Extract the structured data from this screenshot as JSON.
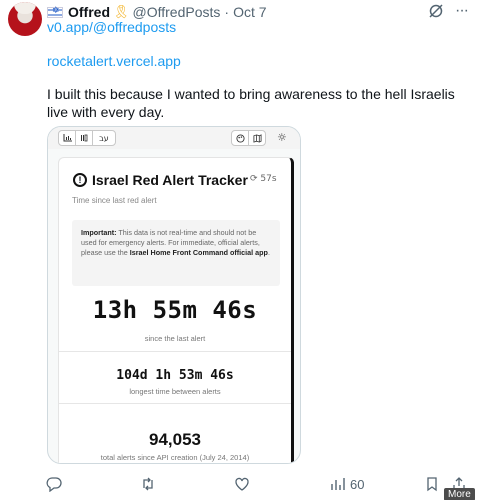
{
  "author": {
    "name": "Offred",
    "handle": "@OffredPosts",
    "separator": "·",
    "date": "Oct 7"
  },
  "post": {
    "link_top": "v0.app/@offredposts",
    "link": "rocketalert.vercel.app",
    "text": "I built this because I wanted to bring awareness to the hell Israelis live with every day."
  },
  "embed": {
    "toolbar": {
      "hebrew_button": "עב"
    },
    "title": "Israel Red Alert Tracker",
    "refresh_seconds": "57s",
    "subtitle": "Time since last red alert",
    "notice": {
      "label": "Important:",
      "body": " This data is not real-time and should not be used for emergency alerts. For immediate, official alerts, please use the ",
      "link": "Israel Home Front Command official app",
      "end": "."
    },
    "since_last": "13h 55m 46s",
    "since_last_caption": "since the last alert",
    "longest": "104d 1h 53m 46s",
    "longest_caption": "longest time between alerts",
    "total": "94,053",
    "total_caption": "total alerts since API creation (July 24, 2014)"
  },
  "actions": {
    "views": "60",
    "more_tooltip": "More"
  },
  "colors": {
    "link": "#1d9bf0",
    "muted": "#536471",
    "text": "#0f1419"
  },
  "icons": [
    "israel-flag-icon",
    "yellow-ribbon-icon",
    "grok-icon",
    "more-icon",
    "bar-chart-icon",
    "map-icon",
    "palette-icon",
    "sun-icon",
    "alert-circle-icon",
    "refresh-icon",
    "reply-icon",
    "repost-icon",
    "like-icon",
    "views-icon",
    "bookmark-icon",
    "share-icon"
  ]
}
